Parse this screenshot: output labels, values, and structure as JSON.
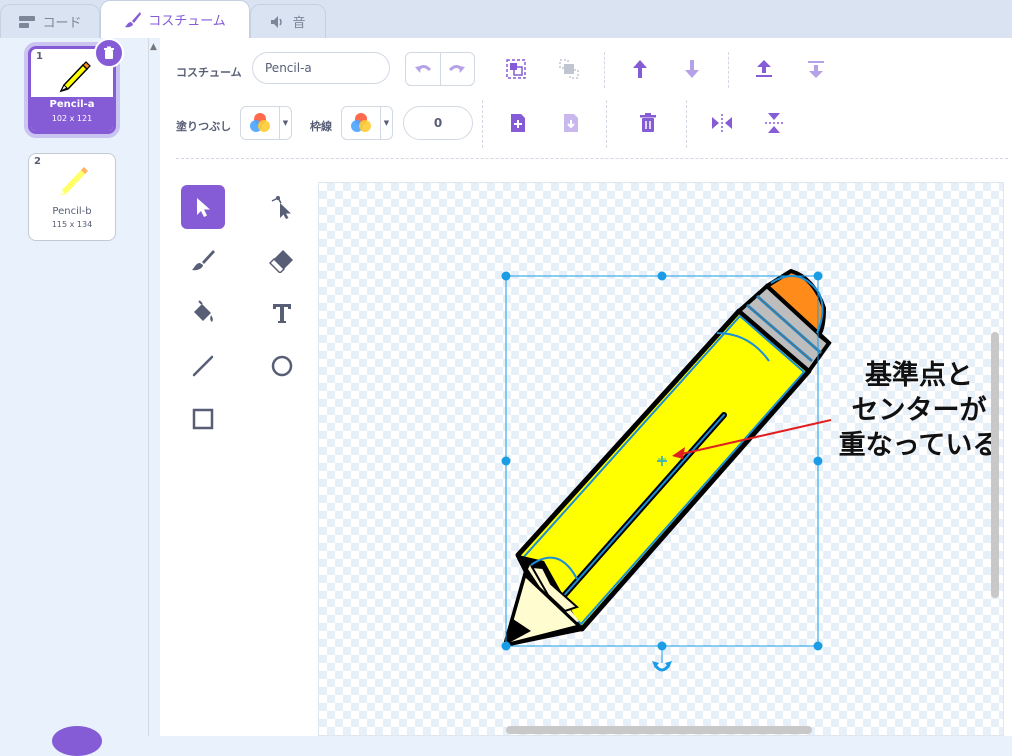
{
  "tabs": [
    {
      "label": "コード",
      "icon": "code-blocks-icon"
    },
    {
      "label": "コスチューム",
      "icon": "paintbrush-icon",
      "active": true
    },
    {
      "label": "音",
      "icon": "speaker-icon"
    }
  ],
  "costumes": [
    {
      "index": "1",
      "name": "Pencil-a",
      "size": "102 x 121",
      "selected": true
    },
    {
      "index": "2",
      "name": "Pencil-b",
      "size": "115 x 134",
      "selected": false
    }
  ],
  "toolbar": {
    "costume_label": "コスチューム",
    "costume_name": "Pencil-a",
    "fill_label": "塗りつぶし",
    "outline_label": "枠線",
    "outline_width": "0"
  },
  "tools": [
    "select",
    "reshape",
    "brush",
    "eraser",
    "fill",
    "text",
    "line",
    "circle",
    "rectangle"
  ],
  "annotation": {
    "line1": "基準点と",
    "line2": "センターが",
    "line3": "重なっている"
  },
  "colors": {
    "accent": "#855cd6",
    "pencil_body": "#ffff00",
    "eraser": "#ff8c1a",
    "selection": "#1a9de4",
    "arrow": "#e02020"
  }
}
